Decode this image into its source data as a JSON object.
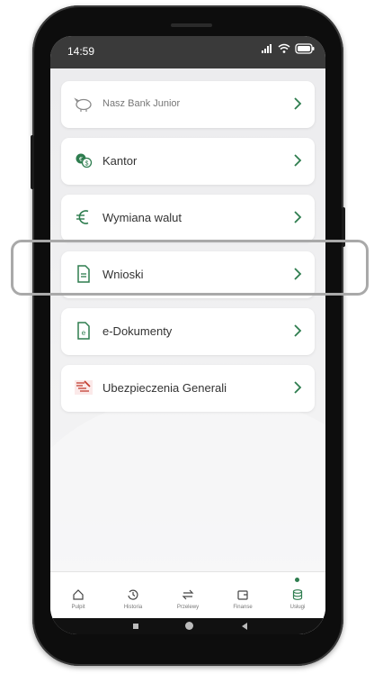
{
  "status_bar": {
    "time": "14:59"
  },
  "menu": {
    "items": [
      {
        "label": "Nasz Bank Junior",
        "icon": "piggy-bank-icon"
      },
      {
        "label": "Kantor",
        "icon": "currency-exchange-icon"
      },
      {
        "label": "Wymiana walut",
        "icon": "euro-icon"
      },
      {
        "label": "Wnioski",
        "icon": "document-icon"
      },
      {
        "label": "e-Dokumenty",
        "icon": "e-document-icon"
      },
      {
        "label": "Ubezpieczenia Generali",
        "icon": "generali-logo-icon"
      }
    ],
    "highlighted_item": "Wnioski"
  },
  "bottom_nav": {
    "items": [
      {
        "label": "Pulpit",
        "icon": "home-icon"
      },
      {
        "label": "Historia",
        "icon": "history-icon"
      },
      {
        "label": "Przelewy",
        "icon": "transfer-icon"
      },
      {
        "label": "Finanse",
        "icon": "wallet-icon"
      },
      {
        "label": "Usługi",
        "icon": "services-icon"
      }
    ],
    "active": "Usługi"
  },
  "colors": {
    "accent": "#2e7d4f",
    "status_bar": "#3a3a3a"
  }
}
